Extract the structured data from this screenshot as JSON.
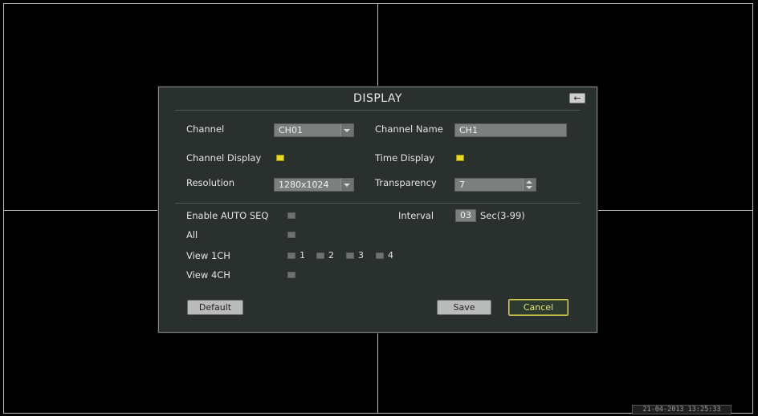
{
  "dialog": {
    "title": "DISPLAY",
    "back_icon": "arrow-left-icon",
    "channel_label": "Channel",
    "channel_value": "CH01",
    "channel_name_label": "Channel Name",
    "channel_name_value": "CH1",
    "channel_display_label": "Channel Display",
    "channel_display_checked": true,
    "time_display_label": "Time Display",
    "time_display_checked": true,
    "resolution_label": "Resolution",
    "resolution_value": "1280x1024",
    "transparency_label": "Transparency",
    "transparency_value": "7",
    "auto_seq_label": "Enable AUTO SEQ",
    "auto_seq_checked": false,
    "interval_label": "Interval",
    "interval_value": "03",
    "interval_unit": "Sec(3-99)",
    "all_label": "All",
    "view1_label": "View 1CH",
    "view1_channels": [
      "1",
      "2",
      "3",
      "4"
    ],
    "view4_label": "View 4CH",
    "default_button": "Default",
    "save_button": "Save",
    "cancel_button": "Cancel"
  },
  "status_bar": {
    "datetime": "21-04-2013 13:25:33"
  },
  "colors": {
    "dialog_bg": "#29302e",
    "checkbox_on": "#e8dc2a",
    "cancel_border": "#d6cf55"
  }
}
